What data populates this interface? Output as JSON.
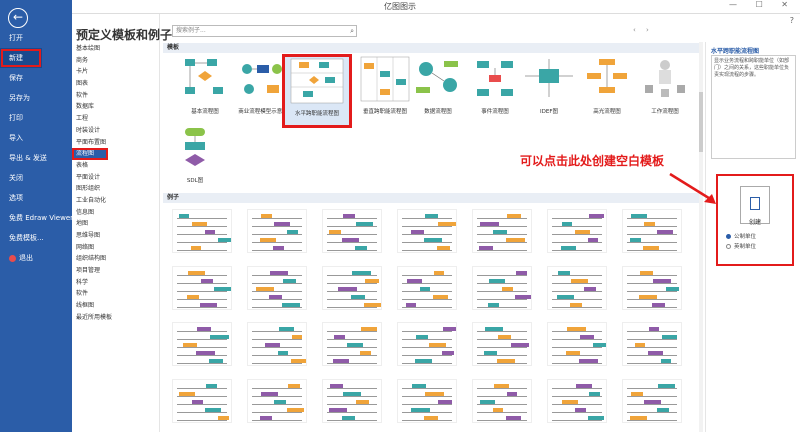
{
  "window": {
    "title": "亿图图示",
    "controls": "— ☐ ✕",
    "help": "?"
  },
  "menu": {
    "back_icon": "arrow-left-icon",
    "items": [
      {
        "label": "打开"
      },
      {
        "label": "新建",
        "active": true
      },
      {
        "label": "保存"
      },
      {
        "label": "另存为"
      },
      {
        "label": "打印"
      },
      {
        "label": "导入"
      },
      {
        "label": "导出 & 发送"
      },
      {
        "label": "关闭"
      },
      {
        "label": "选项"
      },
      {
        "label": "免费 Edraw Viewer"
      },
      {
        "label": "免费模板..."
      },
      {
        "label": "退出"
      }
    ]
  },
  "page_title": "预定义模板和例子",
  "search": {
    "placeholder": "搜索例子...",
    "icon": "search-icon"
  },
  "nav_arrows": "‹ ›",
  "categories": [
    "基本绘图",
    "商务",
    "卡片",
    "图表",
    "软件",
    "数据库",
    "工程",
    "时装设计",
    "平面布置图",
    "流程图",
    "表格",
    "平面设计",
    "图形组织",
    "工业自动化",
    "信息图",
    "地图",
    "思维导图",
    "网络图",
    "组织结构图",
    "项目管理",
    "科学",
    "软件",
    "线框图",
    "最近所用模板"
  ],
  "active_category": "流程图",
  "sections": {
    "templates": "模板",
    "examples": "例子"
  },
  "templates": [
    {
      "label": "基本流程图"
    },
    {
      "label": "商业流程模型示意图"
    },
    {
      "label": "水平跨职能流程图",
      "selected": true
    },
    {
      "label": "垂直跨职能流程图"
    },
    {
      "label": "数据流程图"
    },
    {
      "label": "事件流程图"
    },
    {
      "label": "IDEF图"
    },
    {
      "label": "高光流程图"
    },
    {
      "label": "工作流程图"
    },
    {
      "label": "SDL图"
    }
  ],
  "right_panel": {
    "title": "水平跨职能流程图",
    "description": "显示业务流程和跨职能单位（如部门）之间的关系，这些职能单位负责实现流程的步骤。"
  },
  "annotation": "可以点击此处创建空白模板",
  "create": {
    "label": "创建",
    "options": [
      {
        "label": "公制单位",
        "checked": true
      },
      {
        "label": "英制单位",
        "checked": false
      }
    ]
  },
  "colors": {
    "brand_blue": "#2b5da8",
    "highlight_red": "#e31b1b",
    "teal": "#3aa6a6",
    "orange": "#f0a43a"
  }
}
